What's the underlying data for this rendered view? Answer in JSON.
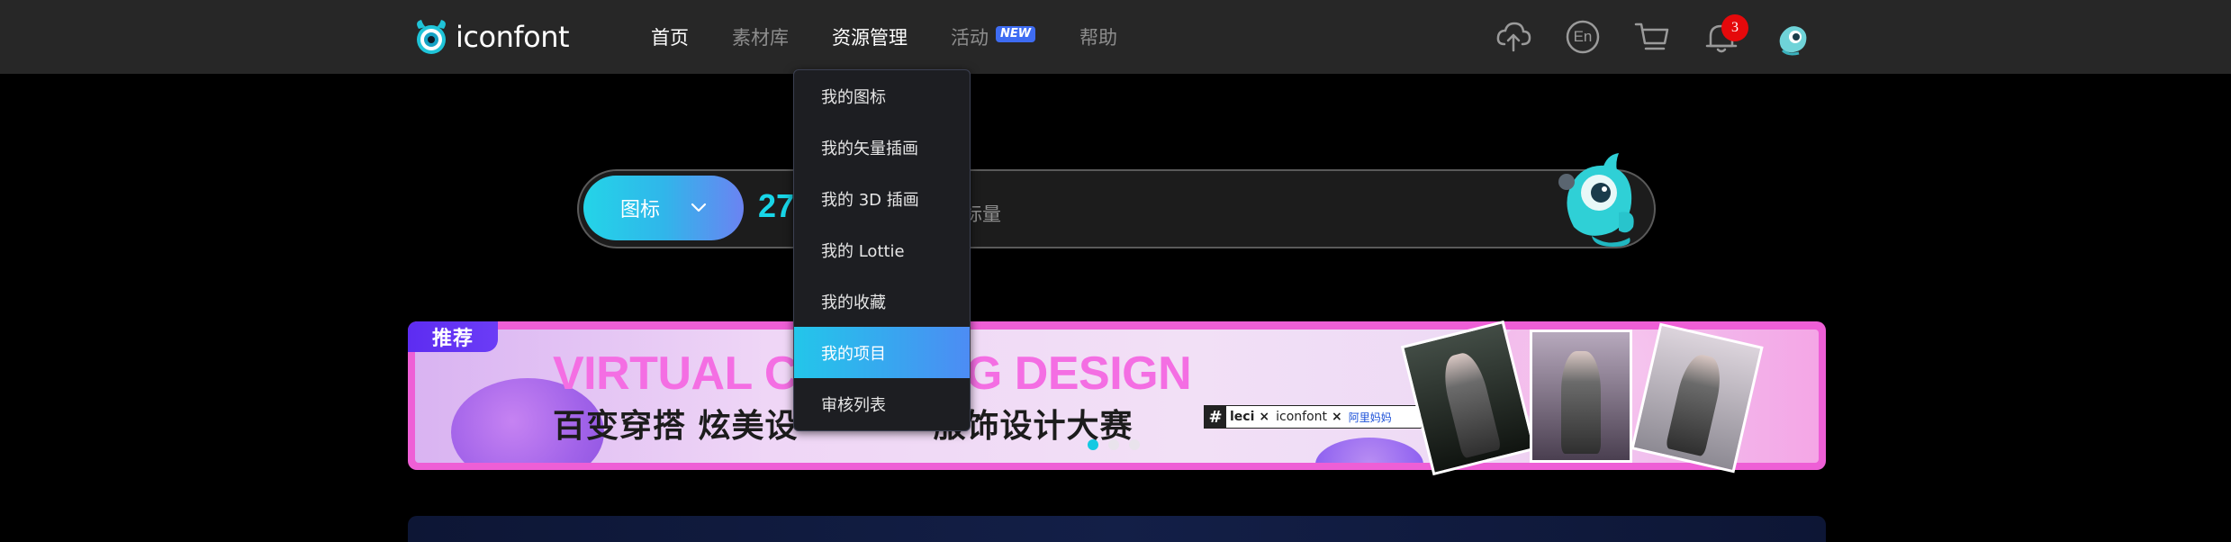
{
  "header": {
    "logo_text": "iconfont",
    "nav": {
      "home": "首页",
      "materials": "素材库",
      "resources": "资源管理",
      "activity": "活动",
      "activity_badge": "NEW",
      "help": "帮助"
    },
    "icons": [
      "upload-icon",
      "language-icon",
      "cart-icon",
      "bell-icon",
      "avatar"
    ],
    "language_label": "En",
    "notification_count": "3"
  },
  "search": {
    "type_label": "图标",
    "count_visible": "27",
    "suffix_visible": "标量"
  },
  "resources_menu": {
    "items": [
      "我的图标",
      "我的矢量插画",
      "我的 3D 插画",
      "我的 Lottie",
      "我的收藏",
      "我的项目",
      "审核列表"
    ],
    "active_index": 5
  },
  "banner": {
    "tag": "推荐",
    "title_en_left": "VIRTUAL C",
    "title_en_right": "G DESIGN",
    "title_zh_left": "百变穿搭 炫美设",
    "title_zh_right": "服饰设计大赛",
    "co_brand": {
      "hash": "#",
      "brand1": "leci",
      "brand2": "iconfont",
      "brand3": "阿里妈妈",
      "separator": "×"
    },
    "slide_count": 3,
    "active_slide": 0
  },
  "colors": {
    "header_bg": "#272727",
    "accent_cyan": "#18d6e8",
    "banner_border": "#ee5fd6",
    "tag_purple": "#5d2cf1",
    "notif_red": "#e5090b"
  }
}
